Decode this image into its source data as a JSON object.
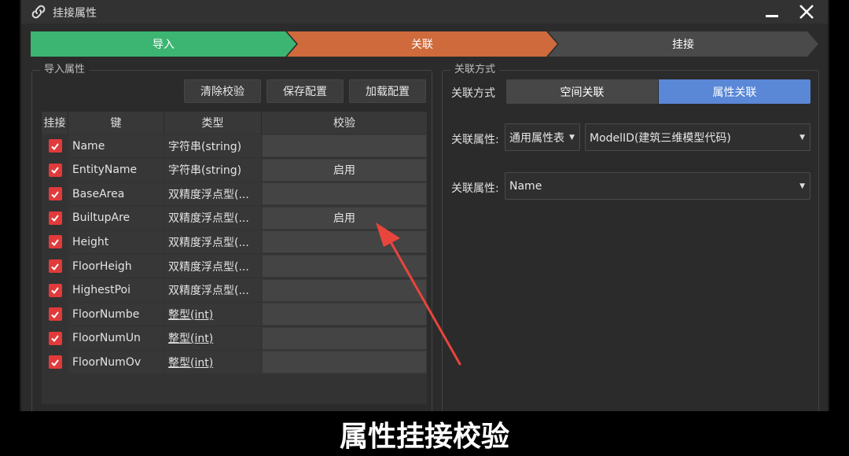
{
  "window": {
    "title": "挂接属性",
    "icon": "link-icon"
  },
  "steps": [
    {
      "label": "导入",
      "color": "#3cb572"
    },
    {
      "label": "关联",
      "color": "#cf6a3c"
    },
    {
      "label": "挂接",
      "color": "#4a4a4a"
    }
  ],
  "left_panel": {
    "title": "导入属性",
    "buttons": {
      "clear": "清除校验",
      "save": "保存配置",
      "load": "加载配置"
    },
    "columns": [
      "挂接",
      "键",
      "类型",
      "校验"
    ],
    "rows": [
      {
        "checked": true,
        "key": "Name",
        "type": "字符串(string)",
        "validate": ""
      },
      {
        "checked": true,
        "key": "EntityName",
        "type": "字符串(string)",
        "validate": "启用"
      },
      {
        "checked": true,
        "key": "BaseArea",
        "type": "双精度浮点型(...",
        "validate": ""
      },
      {
        "checked": true,
        "key": "BuiltupAre",
        "type": "双精度浮点型(...",
        "validate": "启用"
      },
      {
        "checked": true,
        "key": "Height",
        "type": "双精度浮点型(...",
        "validate": ""
      },
      {
        "checked": true,
        "key": "FloorHeigh",
        "type": "双精度浮点型(...",
        "validate": ""
      },
      {
        "checked": true,
        "key": "HighestPoi",
        "type": "双精度浮点型(...",
        "validate": ""
      },
      {
        "checked": true,
        "key": "FloorNumbe",
        "type": "整型(int)",
        "validate": ""
      },
      {
        "checked": true,
        "key": "FloorNumUn",
        "type": "整型(int)",
        "validate": ""
      },
      {
        "checked": true,
        "key": "FloorNumOv",
        "type": "整型(int)",
        "validate": ""
      }
    ]
  },
  "right_panel": {
    "title": "关联方式",
    "mode_label": "关联方式",
    "modes": {
      "spatial": "空间关联",
      "attribute": "属性关联",
      "selected": "属性关联"
    },
    "attr_label_1": "关联属性:",
    "attr_table": "通用属性表",
    "attr_field": "ModelID(建筑三维模型代码)",
    "attr_label_2": "关联属性:",
    "attr_name": "Name"
  },
  "caption": "属性挂接校验",
  "colors": {
    "accent_blue": "#5a87d6",
    "checkbox_red": "#e23a3a",
    "annotation_arrow": "#e8453c"
  }
}
